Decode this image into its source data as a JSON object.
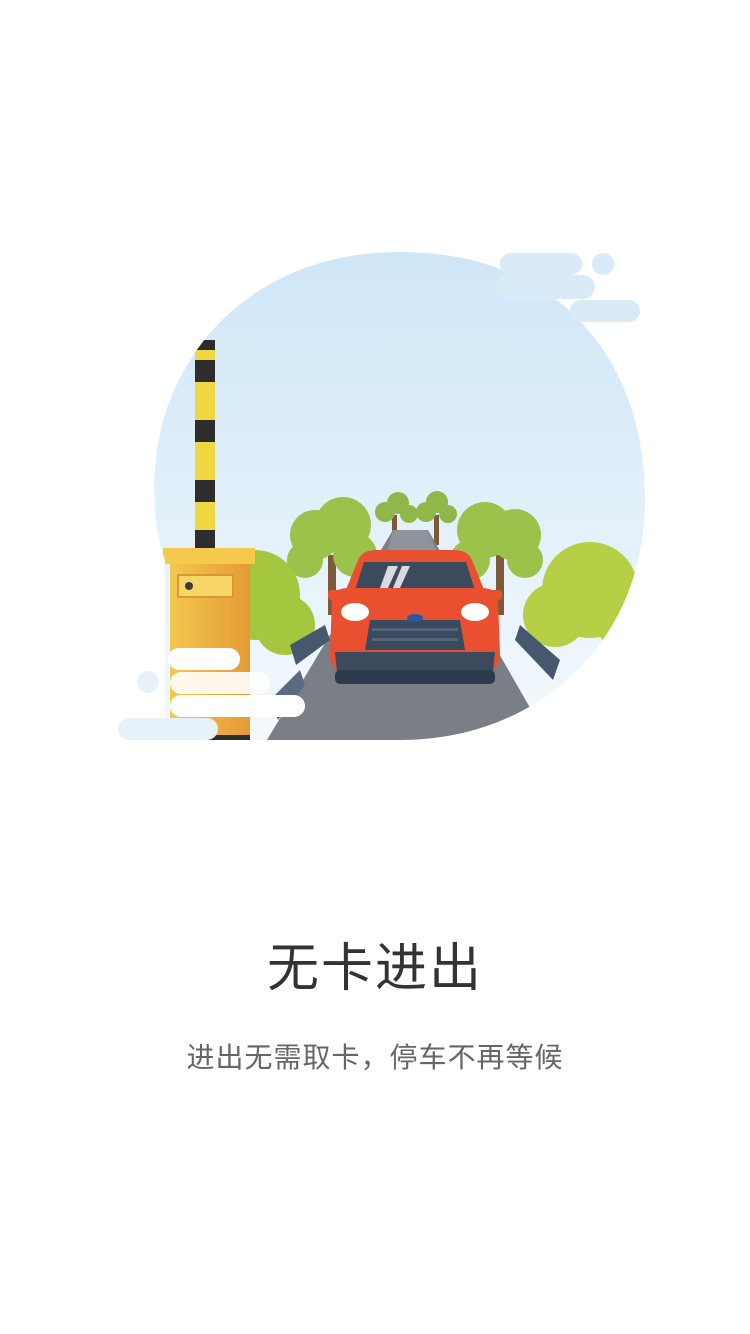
{
  "onboarding": {
    "title": "无卡进出",
    "subtitle": "进出无需取卡，停车不再等候",
    "illustration": {
      "sky_colors": [
        "#cfe6f7",
        "#f4f9fd"
      ],
      "car_color": "#e9502f",
      "tree_color": "#a8c948",
      "barrier_color": "#f2c14a",
      "road_color": "#7a7f86"
    }
  }
}
